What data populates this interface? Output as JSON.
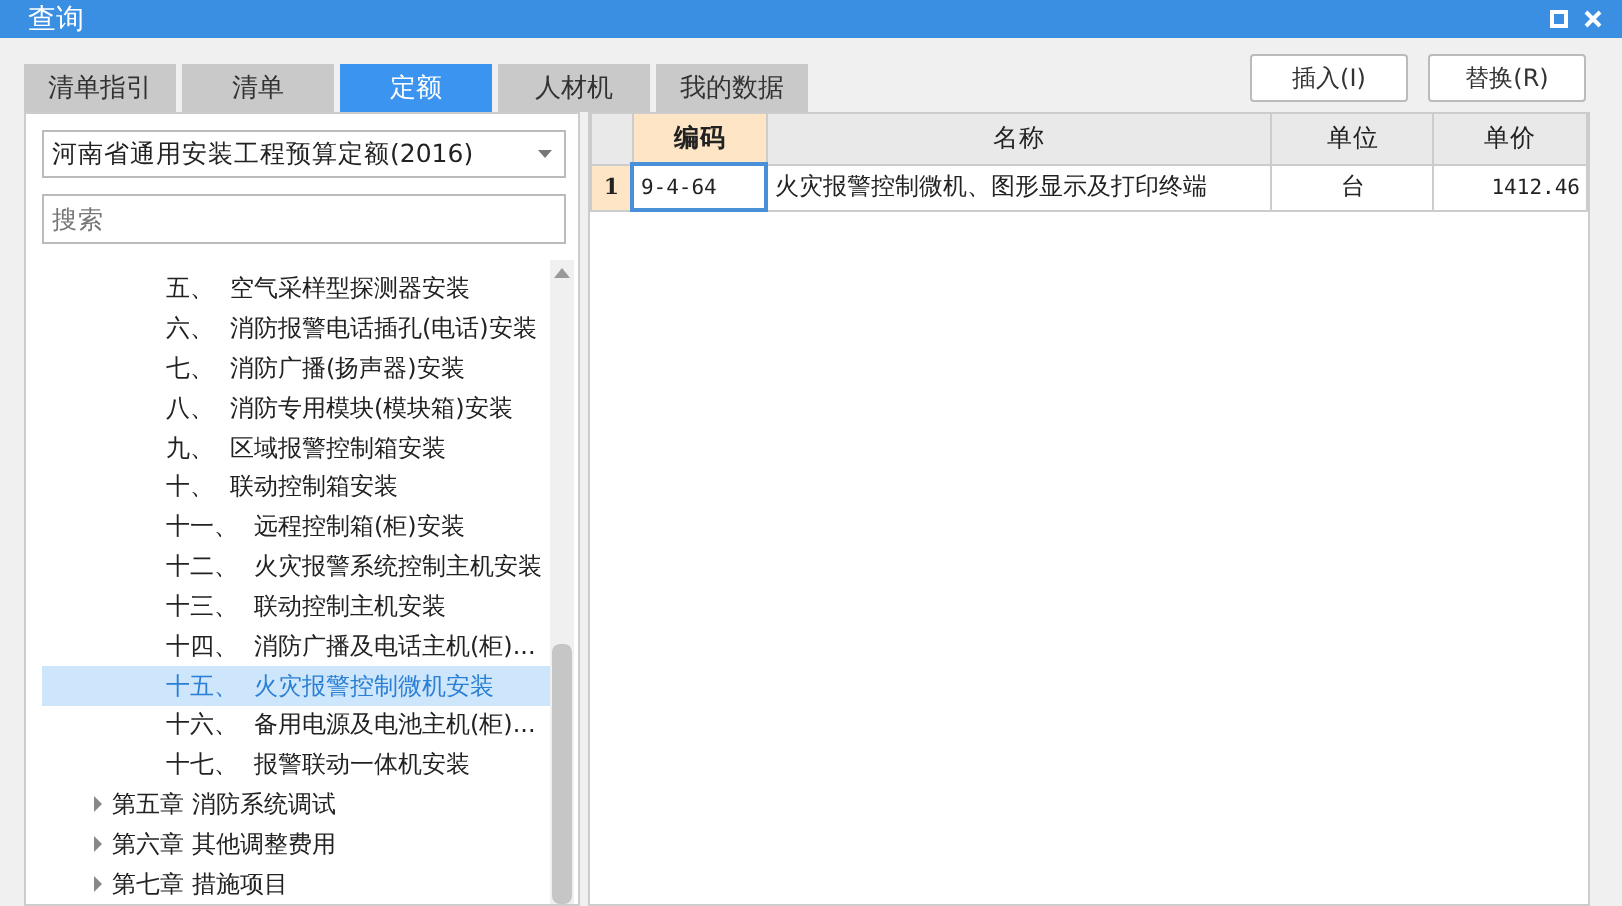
{
  "window": {
    "title": "查询"
  },
  "tabs": [
    {
      "label": "清单指引",
      "selected": false
    },
    {
      "label": "清单",
      "selected": false
    },
    {
      "label": "定额",
      "selected": true
    },
    {
      "label": "人材机",
      "selected": false
    },
    {
      "label": "我的数据",
      "selected": false
    }
  ],
  "buttons": [
    "插入(I)",
    "替换(R)"
  ],
  "library_select": {
    "value": "河南省通用安装工程预算定额(2016)"
  },
  "search": {
    "placeholder": "搜索"
  },
  "tree": {
    "items": [
      {
        "kind": "section",
        "number": "五、",
        "label": "空气采样型探测器安装",
        "selected": false
      },
      {
        "kind": "section",
        "number": "六、",
        "label": "消防报警电话插孔(电话)安装",
        "selected": false
      },
      {
        "kind": "section",
        "number": "七、",
        "label": "消防广播(扬声器)安装",
        "selected": false
      },
      {
        "kind": "section",
        "number": "八、",
        "label": "消防专用模块(模块箱)安装",
        "selected": false
      },
      {
        "kind": "section",
        "number": "九、",
        "label": "区域报警控制箱安装",
        "selected": false
      },
      {
        "kind": "section",
        "number": "十、",
        "label": "联动控制箱安装",
        "selected": false
      },
      {
        "kind": "section",
        "number": "十一、",
        "label": "远程控制箱(柜)安装",
        "selected": false
      },
      {
        "kind": "section",
        "number": "十二、",
        "label": "火灾报警系统控制主机安装",
        "selected": false
      },
      {
        "kind": "section",
        "number": "十三、",
        "label": "联动控制主机安装",
        "selected": false
      },
      {
        "kind": "section",
        "number": "十四、",
        "label": "消防广播及电话主机(柜)...",
        "selected": false
      },
      {
        "kind": "section",
        "number": "十五、",
        "label": "火灾报警控制微机安装",
        "selected": true
      },
      {
        "kind": "section",
        "number": "十六、",
        "label": "备用电源及电池主机(柜)...",
        "selected": false
      },
      {
        "kind": "section",
        "number": "十七、",
        "label": "报警联动一体机安装",
        "selected": false
      },
      {
        "kind": "chapter",
        "number": "第五章",
        "label": "消防系统调试",
        "expanded": false,
        "selected": false
      },
      {
        "kind": "chapter",
        "number": "第六章",
        "label": "其他调整费用",
        "expanded": false,
        "selected": false
      },
      {
        "kind": "chapter",
        "number": "第七章",
        "label": "措施项目",
        "expanded": false,
        "selected": false
      }
    ]
  },
  "table": {
    "columns": [
      "编码",
      "名称",
      "单位",
      "单价"
    ],
    "rows": [
      {
        "index": "1",
        "cells": [
          "9-4-64",
          "火灾报警控制微机、图形显示及打印终端",
          "台",
          "1412.46"
        ]
      }
    ]
  }
}
